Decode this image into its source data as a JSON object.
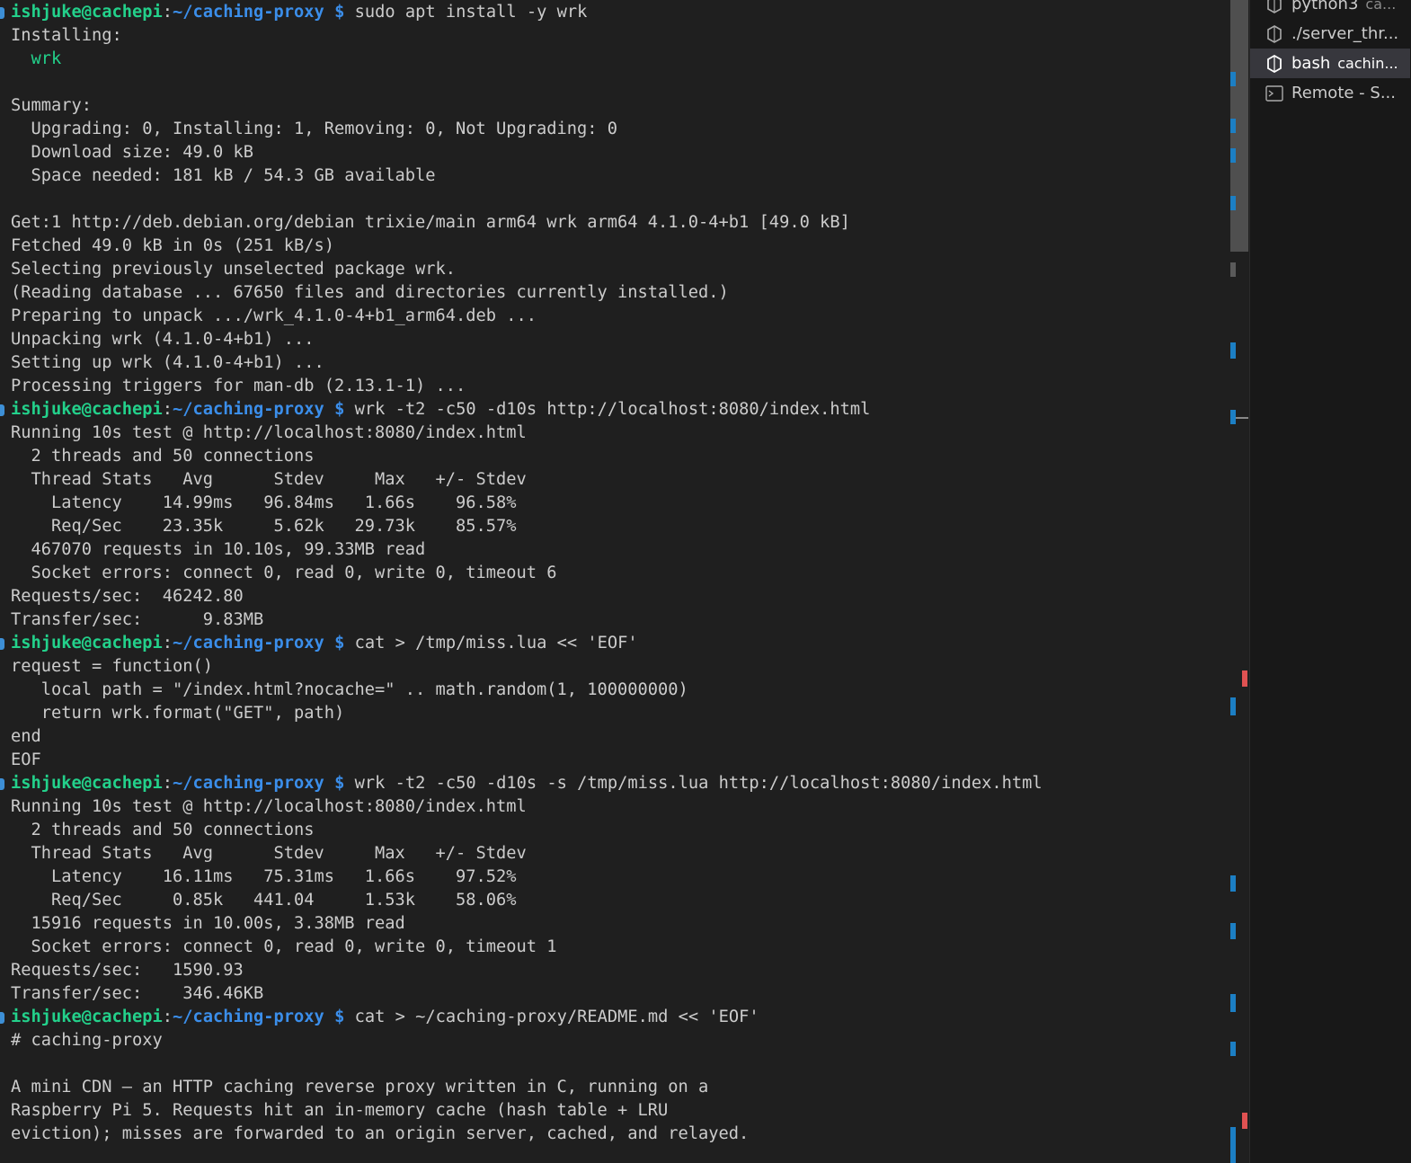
{
  "terminal": {
    "prompt": {
      "user": "ishjuke@cachepi",
      "path": "~/caching-proxy",
      "symbol": "$"
    },
    "lines": [
      {
        "type": "prompt",
        "cmd": "sudo apt install -y wrk"
      },
      {
        "type": "text",
        "text": "Installing:"
      },
      {
        "type": "green",
        "text": "  wrk"
      },
      {
        "type": "text",
        "text": ""
      },
      {
        "type": "text",
        "text": "Summary:"
      },
      {
        "type": "text",
        "text": "  Upgrading: 0, Installing: 1, Removing: 0, Not Upgrading: 0"
      },
      {
        "type": "text",
        "text": "  Download size: 49.0 kB"
      },
      {
        "type": "text",
        "text": "  Space needed: 181 kB / 54.3 GB available"
      },
      {
        "type": "text",
        "text": ""
      },
      {
        "type": "text",
        "text": "Get:1 http://deb.debian.org/debian trixie/main arm64 wrk arm64 4.1.0-4+b1 [49.0 kB]"
      },
      {
        "type": "text",
        "text": "Fetched 49.0 kB in 0s (251 kB/s)"
      },
      {
        "type": "text",
        "text": "Selecting previously unselected package wrk."
      },
      {
        "type": "text",
        "text": "(Reading database ... 67650 files and directories currently installed.)"
      },
      {
        "type": "text",
        "text": "Preparing to unpack .../wrk_4.1.0-4+b1_arm64.deb ..."
      },
      {
        "type": "text",
        "text": "Unpacking wrk (4.1.0-4+b1) ..."
      },
      {
        "type": "text",
        "text": "Setting up wrk (4.1.0-4+b1) ..."
      },
      {
        "type": "text",
        "text": "Processing triggers for man-db (2.13.1-1) ..."
      },
      {
        "type": "prompt",
        "cmd": "wrk -t2 -c50 -d10s http://localhost:8080/index.html"
      },
      {
        "type": "text",
        "text": "Running 10s test @ http://localhost:8080/index.html"
      },
      {
        "type": "text",
        "text": "  2 threads and 50 connections"
      },
      {
        "type": "text",
        "text": "  Thread Stats   Avg      Stdev     Max   +/- Stdev"
      },
      {
        "type": "text",
        "text": "    Latency    14.99ms   96.84ms   1.66s    96.58%"
      },
      {
        "type": "text",
        "text": "    Req/Sec    23.35k     5.62k   29.73k    85.57%"
      },
      {
        "type": "text",
        "text": "  467070 requests in 10.10s, 99.33MB read"
      },
      {
        "type": "text",
        "text": "  Socket errors: connect 0, read 0, write 0, timeout 6"
      },
      {
        "type": "text",
        "text": "Requests/sec:  46242.80"
      },
      {
        "type": "text",
        "text": "Transfer/sec:      9.83MB"
      },
      {
        "type": "prompt",
        "cmd": "cat > /tmp/miss.lua << 'EOF'"
      },
      {
        "type": "text",
        "text": "request = function()"
      },
      {
        "type": "text",
        "text": "   local path = \"/index.html?nocache=\" .. math.random(1, 100000000)"
      },
      {
        "type": "text",
        "text": "   return wrk.format(\"GET\", path)"
      },
      {
        "type": "text",
        "text": "end"
      },
      {
        "type": "text",
        "text": "EOF"
      },
      {
        "type": "prompt",
        "cmd": "wrk -t2 -c50 -d10s -s /tmp/miss.lua http://localhost:8080/index.html"
      },
      {
        "type": "text",
        "text": "Running 10s test @ http://localhost:8080/index.html"
      },
      {
        "type": "text",
        "text": "  2 threads and 50 connections"
      },
      {
        "type": "text",
        "text": "  Thread Stats   Avg      Stdev     Max   +/- Stdev"
      },
      {
        "type": "text",
        "text": "    Latency    16.11ms   75.31ms   1.66s    97.52%"
      },
      {
        "type": "text",
        "text": "    Req/Sec     0.85k   441.04     1.53k    58.06%"
      },
      {
        "type": "text",
        "text": "  15916 requests in 10.00s, 3.38MB read"
      },
      {
        "type": "text",
        "text": "  Socket errors: connect 0, read 0, write 0, timeout 1"
      },
      {
        "type": "text",
        "text": "Requests/sec:   1590.93"
      },
      {
        "type": "text",
        "text": "Transfer/sec:    346.46KB"
      },
      {
        "type": "prompt",
        "cmd": "cat > ~/caching-proxy/README.md << 'EOF'"
      },
      {
        "type": "text",
        "text": "# caching-proxy"
      },
      {
        "type": "text",
        "text": ""
      },
      {
        "type": "text",
        "text": "A mini CDN — an HTTP caching reverse proxy written in C, running on a"
      },
      {
        "type": "text",
        "text": "Raspberry Pi 5. Requests hit an in-memory cache (hash table + LRU"
      },
      {
        "type": "text",
        "text": "eviction); misses are forwarded to an origin server, cached, and relayed."
      }
    ]
  },
  "sidebar": {
    "items": [
      {
        "icon": "python-icon",
        "label": "python3",
        "desc": "ca...",
        "active": false
      },
      {
        "icon": "terminal-process-icon",
        "label": "./server_thr...",
        "desc": "",
        "active": false
      },
      {
        "icon": "bash-icon",
        "label": "bash",
        "desc": "cachin...",
        "active": true
      },
      {
        "icon": "remote-terminal-icon",
        "label": "Remote - S...",
        "desc": "",
        "active": false
      }
    ]
  },
  "colors": {
    "user": "#23d18b",
    "path": "#3b8eea",
    "text": "#cccccc",
    "background": "#1f1f1f",
    "scroll_mark_blue": "#1c7fc4",
    "scroll_mark_red": "#e05252"
  }
}
